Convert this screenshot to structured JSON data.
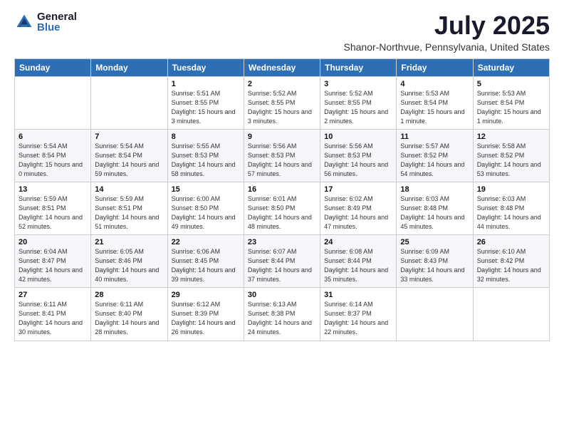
{
  "logo": {
    "general": "General",
    "blue": "Blue"
  },
  "title": "July 2025",
  "subtitle": "Shanor-Northvue, Pennsylvania, United States",
  "days_of_week": [
    "Sunday",
    "Monday",
    "Tuesday",
    "Wednesday",
    "Thursday",
    "Friday",
    "Saturday"
  ],
  "weeks": [
    [
      {
        "day": "",
        "info": ""
      },
      {
        "day": "",
        "info": ""
      },
      {
        "day": "1",
        "info": "Sunrise: 5:51 AM\nSunset: 8:55 PM\nDaylight: 15 hours\nand 3 minutes."
      },
      {
        "day": "2",
        "info": "Sunrise: 5:52 AM\nSunset: 8:55 PM\nDaylight: 15 hours\nand 3 minutes."
      },
      {
        "day": "3",
        "info": "Sunrise: 5:52 AM\nSunset: 8:55 PM\nDaylight: 15 hours\nand 2 minutes."
      },
      {
        "day": "4",
        "info": "Sunrise: 5:53 AM\nSunset: 8:54 PM\nDaylight: 15 hours\nand 1 minute."
      },
      {
        "day": "5",
        "info": "Sunrise: 5:53 AM\nSunset: 8:54 PM\nDaylight: 15 hours\nand 1 minute."
      }
    ],
    [
      {
        "day": "6",
        "info": "Sunrise: 5:54 AM\nSunset: 8:54 PM\nDaylight: 15 hours\nand 0 minutes."
      },
      {
        "day": "7",
        "info": "Sunrise: 5:54 AM\nSunset: 8:54 PM\nDaylight: 14 hours\nand 59 minutes."
      },
      {
        "day": "8",
        "info": "Sunrise: 5:55 AM\nSunset: 8:53 PM\nDaylight: 14 hours\nand 58 minutes."
      },
      {
        "day": "9",
        "info": "Sunrise: 5:56 AM\nSunset: 8:53 PM\nDaylight: 14 hours\nand 57 minutes."
      },
      {
        "day": "10",
        "info": "Sunrise: 5:56 AM\nSunset: 8:53 PM\nDaylight: 14 hours\nand 56 minutes."
      },
      {
        "day": "11",
        "info": "Sunrise: 5:57 AM\nSunset: 8:52 PM\nDaylight: 14 hours\nand 54 minutes."
      },
      {
        "day": "12",
        "info": "Sunrise: 5:58 AM\nSunset: 8:52 PM\nDaylight: 14 hours\nand 53 minutes."
      }
    ],
    [
      {
        "day": "13",
        "info": "Sunrise: 5:59 AM\nSunset: 8:51 PM\nDaylight: 14 hours\nand 52 minutes."
      },
      {
        "day": "14",
        "info": "Sunrise: 5:59 AM\nSunset: 8:51 PM\nDaylight: 14 hours\nand 51 minutes."
      },
      {
        "day": "15",
        "info": "Sunrise: 6:00 AM\nSunset: 8:50 PM\nDaylight: 14 hours\nand 49 minutes."
      },
      {
        "day": "16",
        "info": "Sunrise: 6:01 AM\nSunset: 8:50 PM\nDaylight: 14 hours\nand 48 minutes."
      },
      {
        "day": "17",
        "info": "Sunrise: 6:02 AM\nSunset: 8:49 PM\nDaylight: 14 hours\nand 47 minutes."
      },
      {
        "day": "18",
        "info": "Sunrise: 6:03 AM\nSunset: 8:48 PM\nDaylight: 14 hours\nand 45 minutes."
      },
      {
        "day": "19",
        "info": "Sunrise: 6:03 AM\nSunset: 8:48 PM\nDaylight: 14 hours\nand 44 minutes."
      }
    ],
    [
      {
        "day": "20",
        "info": "Sunrise: 6:04 AM\nSunset: 8:47 PM\nDaylight: 14 hours\nand 42 minutes."
      },
      {
        "day": "21",
        "info": "Sunrise: 6:05 AM\nSunset: 8:46 PM\nDaylight: 14 hours\nand 40 minutes."
      },
      {
        "day": "22",
        "info": "Sunrise: 6:06 AM\nSunset: 8:45 PM\nDaylight: 14 hours\nand 39 minutes."
      },
      {
        "day": "23",
        "info": "Sunrise: 6:07 AM\nSunset: 8:44 PM\nDaylight: 14 hours\nand 37 minutes."
      },
      {
        "day": "24",
        "info": "Sunrise: 6:08 AM\nSunset: 8:44 PM\nDaylight: 14 hours\nand 35 minutes."
      },
      {
        "day": "25",
        "info": "Sunrise: 6:09 AM\nSunset: 8:43 PM\nDaylight: 14 hours\nand 33 minutes."
      },
      {
        "day": "26",
        "info": "Sunrise: 6:10 AM\nSunset: 8:42 PM\nDaylight: 14 hours\nand 32 minutes."
      }
    ],
    [
      {
        "day": "27",
        "info": "Sunrise: 6:11 AM\nSunset: 8:41 PM\nDaylight: 14 hours\nand 30 minutes."
      },
      {
        "day": "28",
        "info": "Sunrise: 6:11 AM\nSunset: 8:40 PM\nDaylight: 14 hours\nand 28 minutes."
      },
      {
        "day": "29",
        "info": "Sunrise: 6:12 AM\nSunset: 8:39 PM\nDaylight: 14 hours\nand 26 minutes."
      },
      {
        "day": "30",
        "info": "Sunrise: 6:13 AM\nSunset: 8:38 PM\nDaylight: 14 hours\nand 24 minutes."
      },
      {
        "day": "31",
        "info": "Sunrise: 6:14 AM\nSunset: 8:37 PM\nDaylight: 14 hours\nand 22 minutes."
      },
      {
        "day": "",
        "info": ""
      },
      {
        "day": "",
        "info": ""
      }
    ]
  ]
}
